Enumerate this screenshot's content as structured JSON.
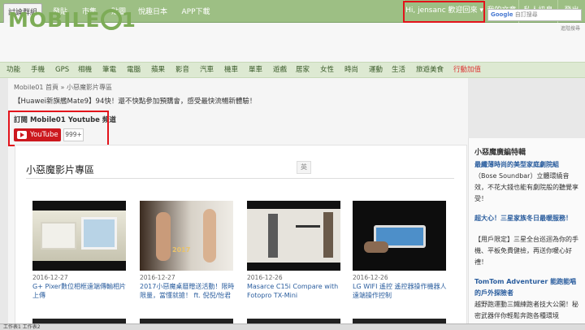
{
  "topbar": {
    "tabs": [
      "討論群組",
      "發貼",
      "市集",
      "貼圖",
      "悅趣日本",
      "APP下載"
    ],
    "user_greeting": "Hi, jensanc 歡迎回來 ▾",
    "my_articles": "我的文章",
    "messages": "私人訊息",
    "logout": "登出"
  },
  "header": {
    "logo_prefix": "MOBILE",
    "logo_suffix": "1",
    "search_google": "Google",
    "search_placeholder": "自訂搜尋",
    "search_sub": "進階搜尋"
  },
  "nav": {
    "items": [
      "功能",
      "手機",
      "GPS",
      "相機",
      "筆電",
      "電腦",
      "蘋果",
      "影音",
      "汽車",
      "機車",
      "單車",
      "遊戲",
      "居家",
      "女性",
      "時尚",
      "運動",
      "生活",
      "旅遊美食",
      "行動加值"
    ]
  },
  "breadcrumb": "Mobile01 首頁 » 小惡魔影片專區",
  "notice": "【Huawei新旗艦Mate9】94快！還不快點參加預購會，感受最快流暢新體驗！",
  "subscribe": {
    "title": "訂閱 Mobile01 Youtube 頻道",
    "button": "YouTube",
    "count": "999+"
  },
  "panel": {
    "title": "小惡魔影片專區",
    "badge": "英"
  },
  "videos": [
    {
      "date": "2016-12-27",
      "title": "G+ Pixer數位相框遠端傳輸相片上傳"
    },
    {
      "date": "2016-12-27",
      "title": "2017小惡魔桌曆贈送活動！限時限量，當懂就搶！ ft. 倪倪/怡君"
    },
    {
      "date": "2016-12-26",
      "title": "Masarce C15i Compare with Fotopro TX-Mini"
    },
    {
      "date": "2016-12-26",
      "title": "LG WIFI 遙控 遙控器操作機器人 遠端操作控制"
    }
  ],
  "sidebar": {
    "heading": "小惡魔廣編特輯",
    "blocks": [
      {
        "link": "最纖薄時尚的美型家庭劇院組",
        "text": "（Bose Soundbar）立體環繞音效，不花大錢也能有劇院般的聽覺享受！"
      },
      {
        "link": "超大心！三星家族冬日最暖服務！",
        "text": "【用戶限定】三星全台巡迴為你的手機、平板免費健檢，再送你暖心好禮！"
      },
      {
        "link": "TomTom Adventurer 能跑能唱的戶外探險者",
        "text": "越野跑運動三鐵練跑者技大公開！秘密武器伴你輕鬆奔跑各種環境"
      }
    ]
  },
  "taskbar": "工作表1  工作表2"
}
